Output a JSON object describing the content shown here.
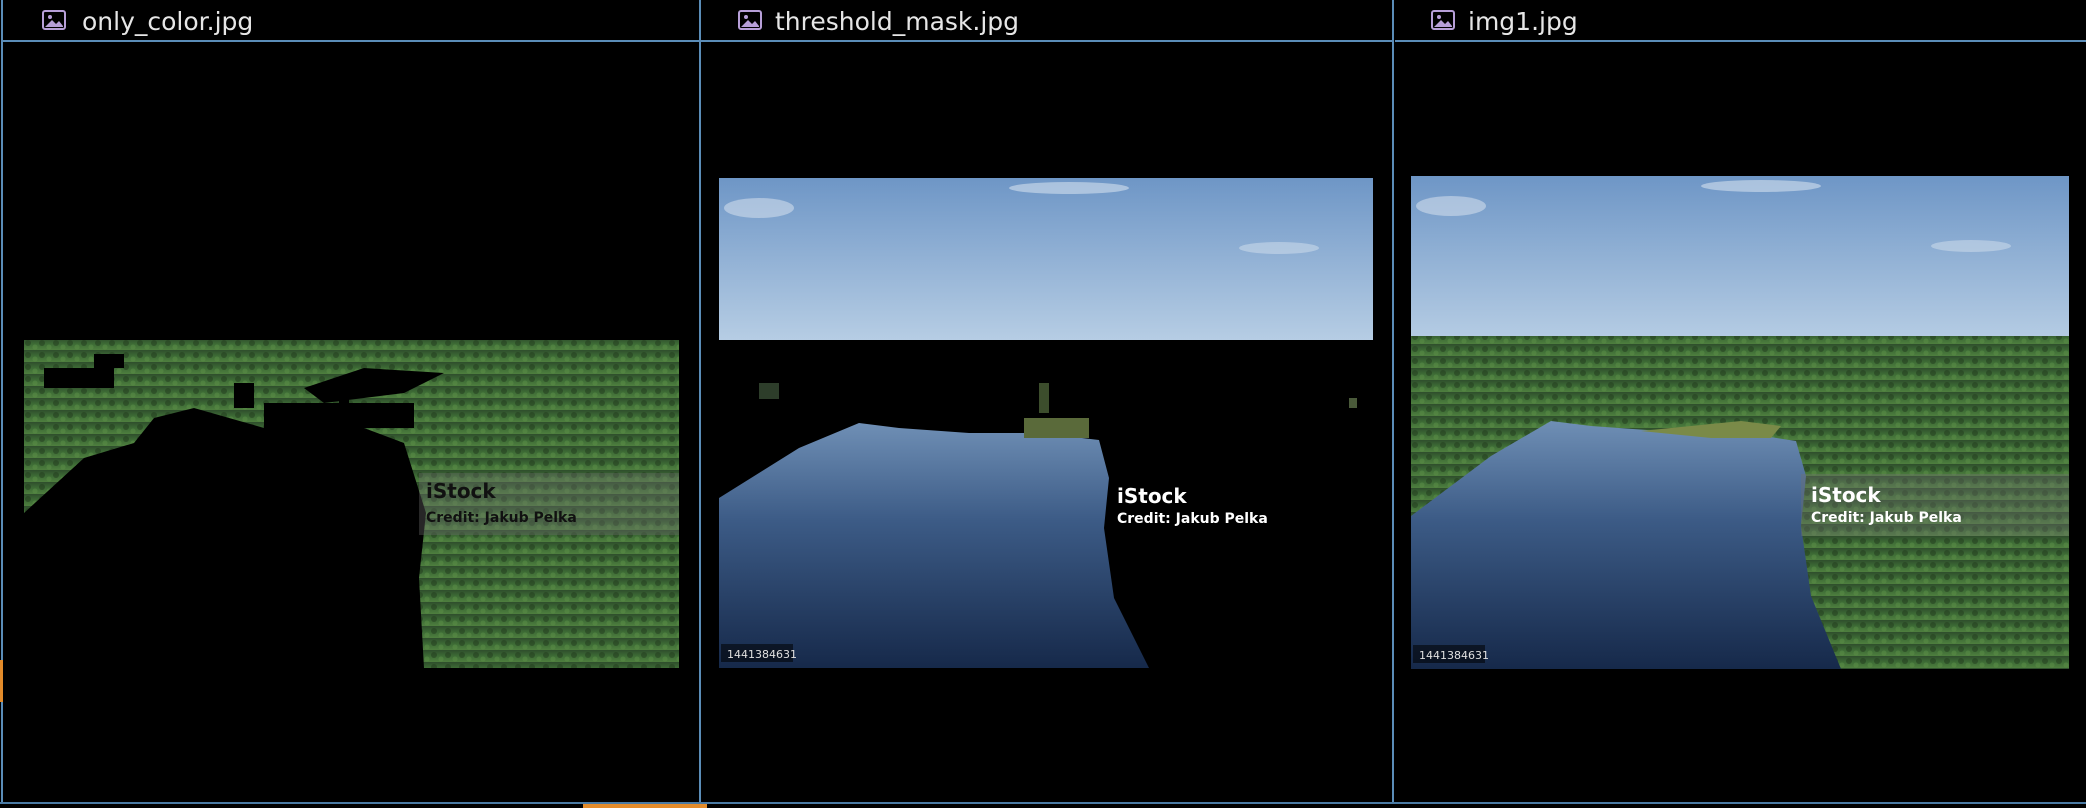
{
  "panes": [
    {
      "file_name": "only_color.jpg",
      "icon": "image-file-icon",
      "watermark": {
        "brand": "iStock",
        "credit": "Credit: Jakub Pelka"
      },
      "image_id": ""
    },
    {
      "file_name": "threshold_mask.jpg",
      "icon": "image-file-icon",
      "watermark": {
        "brand": "iStock",
        "credit": "Credit: Jakub Pelka"
      },
      "image_id": "1441384631"
    },
    {
      "file_name": "img1.jpg",
      "icon": "image-file-icon",
      "watermark": {
        "brand": "iStock",
        "credit": "Credit: Jakub Pelka"
      },
      "image_id": "1441384631"
    }
  ],
  "colors": {
    "divider": "#5b8db8",
    "accent": "#e38b2a",
    "icon": "#b79fd8",
    "text": "#e6e6e6"
  }
}
